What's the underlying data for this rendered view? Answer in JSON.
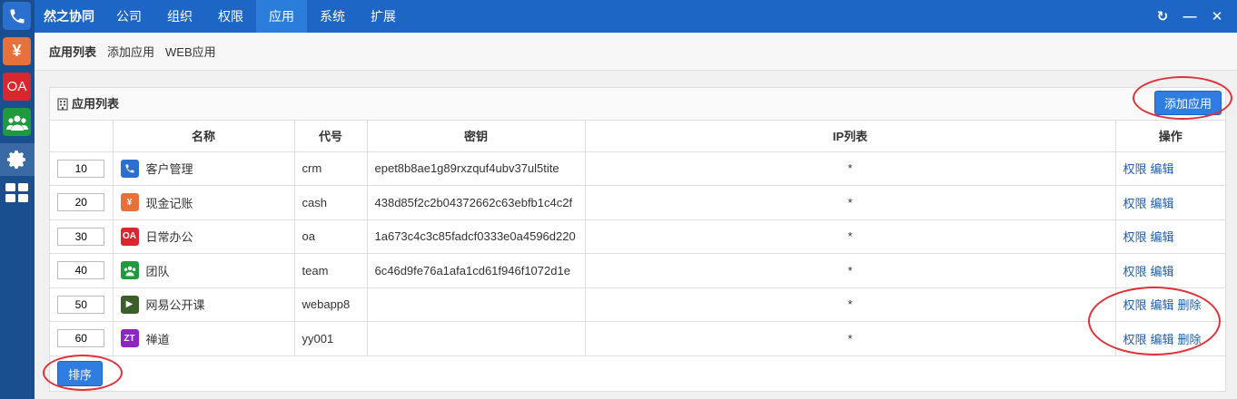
{
  "dock": {
    "items": [
      {
        "name": "phone-icon",
        "glyph": "✆"
      },
      {
        "name": "yen-icon",
        "glyph": "¥"
      },
      {
        "name": "oa-icon",
        "glyph": "OA"
      },
      {
        "name": "team-icon",
        "glyph": ""
      },
      {
        "name": "gear-icon",
        "glyph": ""
      },
      {
        "name": "grid-icon",
        "glyph": ""
      }
    ]
  },
  "topbar": {
    "brand": "然之协同",
    "nav": [
      "公司",
      "组织",
      "权限",
      "应用",
      "系统",
      "扩展"
    ],
    "active_nav": "应用",
    "refresh": "↻",
    "minimize": "—",
    "close": "✕"
  },
  "subnav": {
    "items": [
      "应用列表",
      "添加应用",
      "WEB应用"
    ]
  },
  "panel": {
    "title": "应用列表",
    "add_button": "添加应用",
    "sort_button": "排序",
    "columns": [
      "",
      "名称",
      "代号",
      "密钥",
      "IP列表",
      "操作"
    ],
    "rows": [
      {
        "order": "10",
        "name": "客户管理",
        "code": "crm",
        "key": "epet8b8ae1g89rxzquf4ubv37ul5tite",
        "ip": "*",
        "ops": [
          "权限",
          "编辑"
        ],
        "icon": {
          "type": "phone",
          "color": "#2b6fcf",
          "label": "✆"
        }
      },
      {
        "order": "20",
        "name": "现金记账",
        "code": "cash",
        "key": "438d85f2c2b04372662c63ebfb1c4c2f",
        "ip": "*",
        "ops": [
          "权限",
          "编辑"
        ],
        "icon": {
          "type": "cash",
          "color": "#e8703a",
          "label": "¥"
        }
      },
      {
        "order": "30",
        "name": "日常办公",
        "code": "oa",
        "key": "1a673c4c3c85fadcf0333e0a4596d220",
        "ip": "*",
        "ops": [
          "权限",
          "编辑"
        ],
        "icon": {
          "type": "oa",
          "color": "#d9272e",
          "label": "OA"
        }
      },
      {
        "order": "40",
        "name": "团队",
        "code": "team",
        "key": "6c46d9fe76a1afa1cd61f946f1072d1e",
        "ip": "*",
        "ops": [
          "权限",
          "编辑"
        ],
        "icon": {
          "type": "team",
          "color": "#1f9a3d",
          "label": ""
        }
      },
      {
        "order": "50",
        "name": "网易公开课",
        "code": "webapp8",
        "key": "",
        "ip": "*",
        "ops": [
          "权限",
          "编辑",
          "删除"
        ],
        "icon": {
          "type": "play",
          "color": "#3b5f2a",
          "label": "▶"
        }
      },
      {
        "order": "60",
        "name": "禅道",
        "code": "yy001",
        "key": "",
        "ip": "*",
        "ops": [
          "权限",
          "编辑",
          "删除"
        ],
        "icon": {
          "type": "zt",
          "color": "#8e24c4",
          "label": "ZT"
        }
      }
    ]
  }
}
